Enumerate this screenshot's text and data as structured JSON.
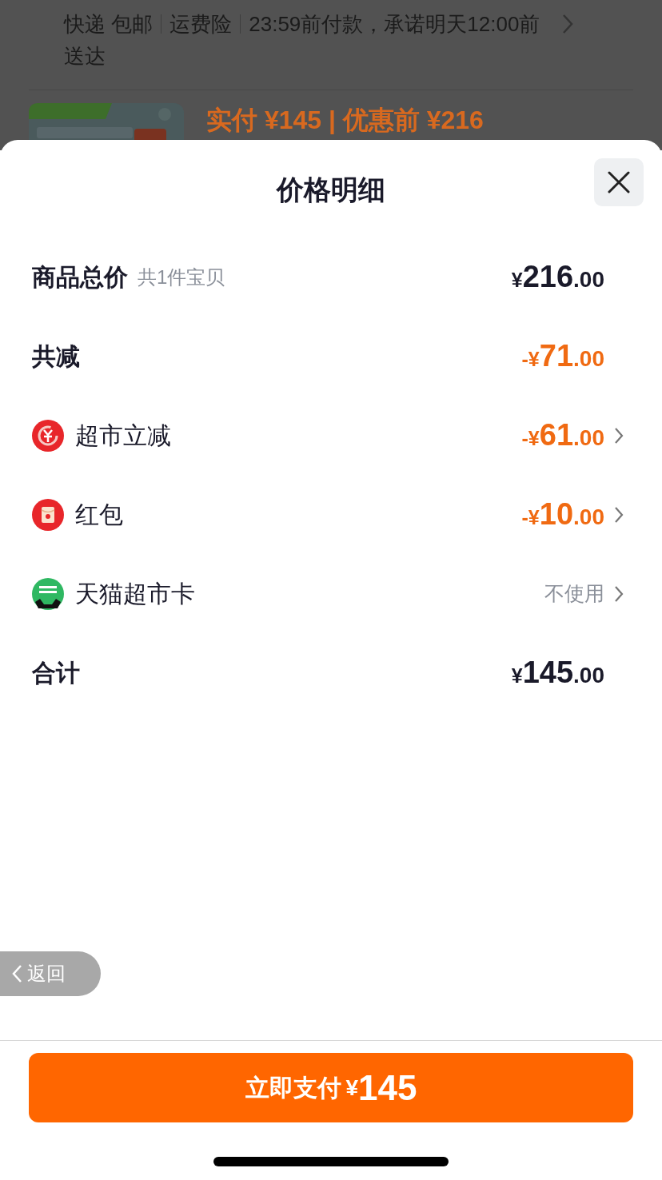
{
  "background": {
    "shipping": [
      {
        "text": "快递 包邮"
      },
      {
        "text": "运费险"
      },
      {
        "text": "23:59前付款，承诺明天12:00前送达"
      }
    ],
    "product": {
      "kind": "picture",
      "price_line": "实付 ¥145 | 优惠前 ¥216"
    }
  },
  "sheet": {
    "title": "价格明细",
    "rows": [
      {
        "kind": "summary",
        "label": "商品总价",
        "note": "共1件宝贝",
        "amount": "¥216.00",
        "discount": false,
        "chevron": false
      },
      {
        "kind": "summary",
        "label": "共减",
        "amount": "-¥71.00",
        "discount": true,
        "chevron": false
      },
      {
        "kind": "instant",
        "label": "超市立减",
        "amount": "-¥61.00",
        "discount": true,
        "chevron": true
      },
      {
        "kind": "packet",
        "label": "红包",
        "amount": "-¥10.00",
        "discount": true,
        "chevron": true
      },
      {
        "kind": "card",
        "label": "天猫超市卡",
        "value": "不使用",
        "chevron": true
      },
      {
        "kind": "summary",
        "label": "合计",
        "amount": "¥145.00",
        "discount": false,
        "chevron": false
      }
    ],
    "back_button": "返回",
    "pay_button": {
      "label": "立即支付",
      "amount": "¥145"
    }
  }
}
